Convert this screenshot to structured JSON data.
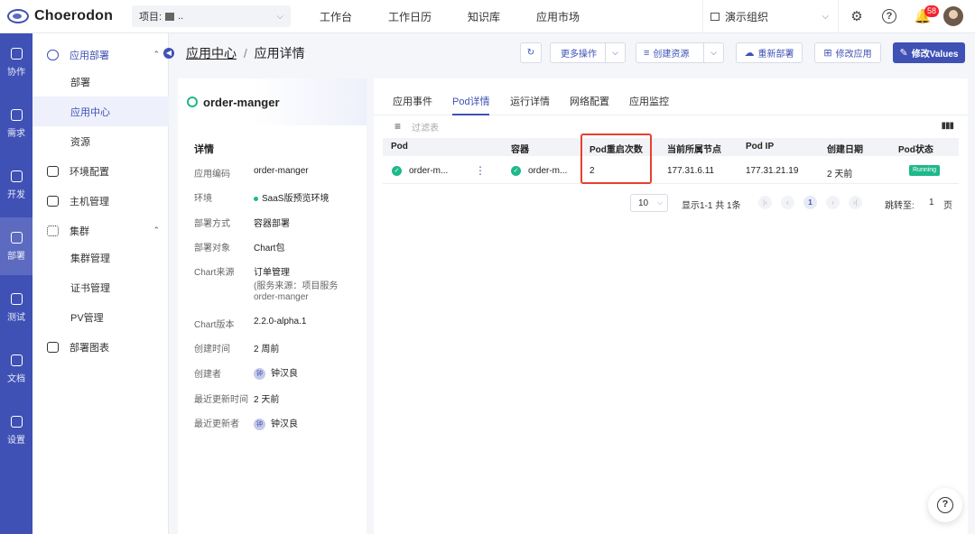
{
  "brand": {
    "name": "Choerodon",
    "accent": "#3f51b5",
    "success": "#1fb88a",
    "highlight": "#e8402d"
  },
  "header": {
    "project_label": "项目:",
    "project_name": "..",
    "nav": [
      "工作台",
      "工作日历",
      "知识库",
      "应用市场"
    ],
    "org_name": "演示组织",
    "notification_count": "58"
  },
  "rail": [
    {
      "label": "协作",
      "icon": "collaboration-icon"
    },
    {
      "label": "需求",
      "icon": "requirement-icon"
    },
    {
      "label": "开发",
      "icon": "code-icon"
    },
    {
      "label": "部署",
      "icon": "deploy-icon"
    },
    {
      "label": "测试",
      "icon": "test-icon"
    },
    {
      "label": "文档",
      "icon": "document-icon"
    },
    {
      "label": "设置",
      "icon": "settings-icon"
    }
  ],
  "sidebar": {
    "deploy_group": "应用部署",
    "deploy_children": [
      "部署",
      "应用中心",
      "资源"
    ],
    "env_config": "环境配置",
    "host_manage": "主机管理",
    "cluster_group": "集群",
    "cluster_children": [
      "集群管理",
      "证书管理",
      "PV管理"
    ],
    "deploy_chart": "部署图表"
  },
  "breadcrumb": {
    "parent": "应用中心",
    "current": "应用详情"
  },
  "actions": {
    "refresh": "",
    "more": "更多操作",
    "create_resource": "创建资源",
    "redeploy": "重新部署",
    "modify_app": "修改应用",
    "modify_values": "修改Values"
  },
  "app": {
    "name": "order-manger",
    "detail_title": "详情",
    "fields": [
      {
        "key": "应用编码",
        "value": "order-manger"
      },
      {
        "key": "环境",
        "value": "SaaS版预览环境"
      },
      {
        "key": "部署方式",
        "value": "容器部署"
      },
      {
        "key": "部署对象",
        "value": "Chart包"
      },
      {
        "key": "Chart来源",
        "value": "订单管理",
        "sub1": "(服务来源：项目服务",
        "sub2": "order-manger"
      },
      {
        "key": "Chart版本",
        "value": "2.2.0-alpha.1"
      },
      {
        "key": "创建时间",
        "value": "2 周前"
      },
      {
        "key": "创建者",
        "value": "钟汉良",
        "avatar": "钟"
      },
      {
        "key": "最近更新时间",
        "value": "2 天前"
      },
      {
        "key": "最近更新者",
        "value": "钟汉良",
        "avatar": "钟"
      }
    ]
  },
  "tabs": [
    "应用事件",
    "Pod详情",
    "运行详情",
    "网络配置",
    "应用监控"
  ],
  "filter": {
    "placeholder": "过滤表"
  },
  "table": {
    "columns": [
      "Pod",
      "容器",
      "Pod重启次数",
      "当前所属节点",
      "Pod IP",
      "创建日期",
      "Pod状态"
    ],
    "rows": [
      {
        "pod": "order-m...",
        "container": "order-m...",
        "restarts": "2",
        "node": "177.31.6.11",
        "ip": "177.31.21.19",
        "created": "2 天前",
        "status": "Running"
      }
    ]
  },
  "pagination": {
    "page_size": "10",
    "summary": "显示1-1 共 1条",
    "current_page": "1",
    "jump_label": "跳转至:",
    "jump_value": "1",
    "page_unit": "页"
  }
}
